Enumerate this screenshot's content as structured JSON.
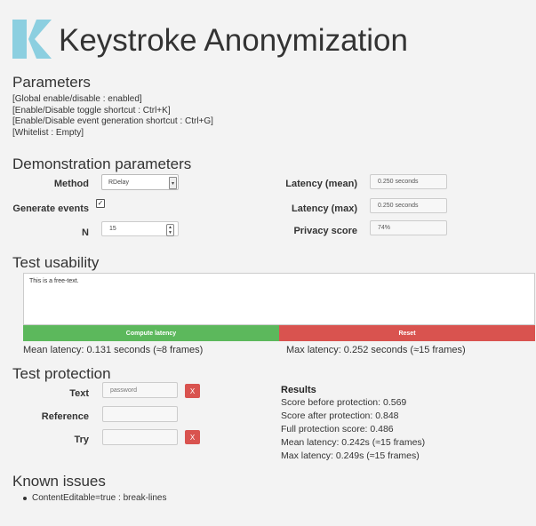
{
  "header": {
    "title": "Keystroke Anonymization"
  },
  "parameters": {
    "heading": "Parameters",
    "lines": [
      "[Global enable/disable : enabled]",
      "[Enable/Disable toggle shortcut : Ctrl+K]",
      "[Enable/Disable event generation shortcut : Ctrl+G]",
      "[Whitelist : Empty]"
    ]
  },
  "demo": {
    "heading": "Demonstration parameters",
    "method_label": "Method",
    "method_value": "RDelay",
    "generate_label": "Generate events",
    "n_label": "N",
    "n_value": "15",
    "latency_mean_label": "Latency (mean)",
    "latency_mean_value": "0.250 seconds",
    "latency_max_label": "Latency (max)",
    "latency_max_value": "0.250 seconds",
    "privacy_label": "Privacy score",
    "privacy_value": "74%"
  },
  "usability": {
    "heading": "Test usability",
    "text": "This is a free-text.",
    "compute_label": "Compute latency",
    "reset_label": "Reset",
    "mean_latency": "Mean latency: 0.131 seconds (≈8 frames)",
    "max_latency": "Max latency: 0.252 seconds (≈15 frames)"
  },
  "protection": {
    "heading": "Test protection",
    "text_label": "Text",
    "text_placeholder": "password",
    "reference_label": "Reference",
    "try_label": "Try",
    "clear_label": "X",
    "results_heading": "Results",
    "results": [
      "Score before protection: 0.569",
      "Score after protection: 0.848",
      "Full protection score: 0.486",
      "Mean latency: 0.242s (≈15 frames)",
      "Max latency: 0.249s (≈15 frames)"
    ]
  },
  "issues": {
    "heading": "Known issues",
    "items": [
      "ContentEditable=true : break-lines"
    ]
  },
  "colors": {
    "logo": "#8ccfe0",
    "compute": "#5cb85c",
    "reset": "#d9534f"
  }
}
